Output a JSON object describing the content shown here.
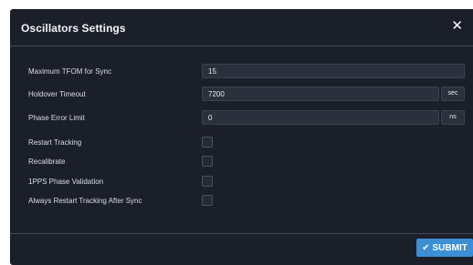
{
  "dialog": {
    "title": "Oscillators Settings",
    "close_glyph": "✕"
  },
  "fields": [
    {
      "label": "Maximum TFOM for Sync",
      "value": "15",
      "unit": ""
    },
    {
      "label": "Holdover Timeout",
      "value": "7200",
      "unit": "sec"
    },
    {
      "label": "Phase Error Limit",
      "value": "0",
      "unit": "ns"
    }
  ],
  "checkboxes": [
    {
      "label": "Restart Tracking",
      "checked": false
    },
    {
      "label": "Recalibrate",
      "checked": false
    },
    {
      "label": "1PPS Phase Validation",
      "checked": false
    },
    {
      "label": "Always Restart Tracking After Sync",
      "checked": false
    }
  ],
  "footer": {
    "submit_label": "SUBMIT",
    "submit_icon": "checkmark-icon"
  },
  "colors": {
    "dialog_bg": "#1b1f2a",
    "input_bg": "#2b303c",
    "accent": "#3b8fd4"
  }
}
